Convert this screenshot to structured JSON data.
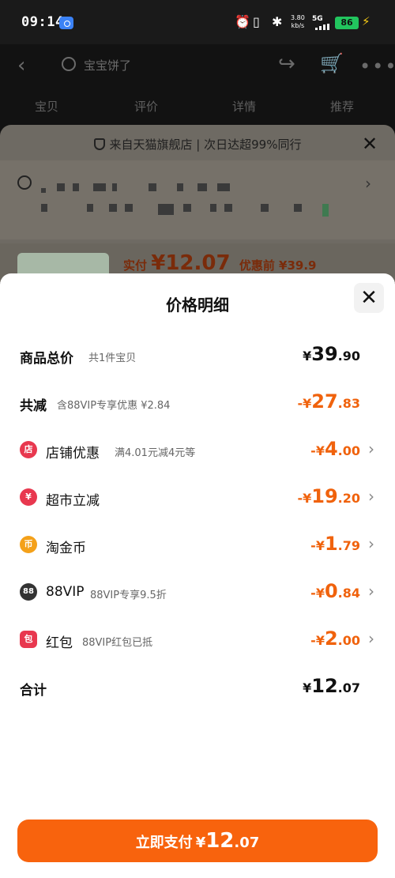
{
  "status_bar": {
    "time": "09:14",
    "net_speed_value": "3.80",
    "net_speed_unit": "kb/s",
    "network": "5G",
    "battery": "86"
  },
  "nav": {
    "search_placeholder": "宝宝饼了",
    "tabs": [
      "宝贝",
      "评价",
      "详情",
      "推荐"
    ]
  },
  "under": {
    "ship_note": "来自天猫旗舰店 | 次日达超99%同行",
    "pay_prefix": "实付",
    "pay_price": "¥12.07",
    "pre_price": "优惠前 ¥39.9"
  },
  "sheet": {
    "title": "价格明细",
    "rows": [
      {
        "label": "商品总价",
        "sub": "共1件宝贝",
        "currency": "¥",
        "int": "39",
        "dec": ".90",
        "negative": false
      },
      {
        "label": "共减",
        "sub": "含88VIP专享优惠 ¥2.84",
        "currency": "-¥",
        "int": "27",
        "dec": ".83",
        "negative": true
      },
      {
        "label": "店铺优惠",
        "sub": "满4.01元减4元等",
        "currency": "-¥",
        "int": "4",
        "dec": ".00",
        "negative": true
      },
      {
        "label": "超市立减",
        "sub": "",
        "currency": "-¥",
        "int": "19",
        "dec": ".20",
        "negative": true
      },
      {
        "label": "淘金币",
        "sub": "",
        "currency": "-¥",
        "int": "1",
        "dec": ".79",
        "negative": true
      },
      {
        "label": "88VIP",
        "sub": "88VIP专享9.5折",
        "currency": "-¥",
        "int": "0",
        "dec": ".84",
        "negative": true
      },
      {
        "label": "红包",
        "sub": "88VIP红包已抵",
        "currency": "-¥",
        "int": "2",
        "dec": ".00",
        "negative": true
      },
      {
        "label": "合计",
        "sub": "",
        "currency": "¥",
        "int": "12",
        "dec": ".07",
        "negative": false
      }
    ],
    "icons": {
      "shop": "店",
      "supermarket": "¥",
      "coin": "币",
      "vip": "88",
      "redpacket": "包"
    }
  },
  "pay_button": {
    "text": "立即支付",
    "currency": "¥",
    "int": "12",
    "dec": ".07"
  },
  "colors": {
    "accent": "#f8630d",
    "discount": "#f0620c",
    "shop_icon": "#e8384f",
    "supermarket_icon": "#e8384f",
    "coin_icon": "#f4a11a",
    "vip_icon": "#333333",
    "redpacket_icon": "#e8384f"
  }
}
